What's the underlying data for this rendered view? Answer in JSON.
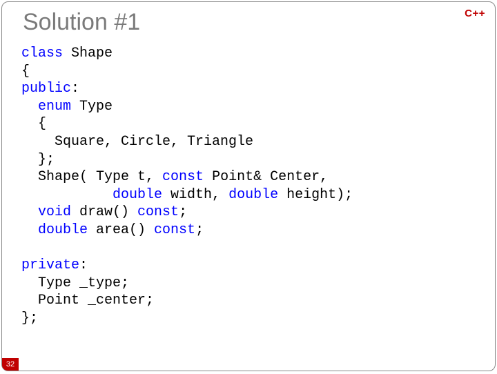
{
  "badge": "C++",
  "title": "Solution #1",
  "page_number": "32",
  "code": {
    "l1_a": "class",
    "l1_b": " Shape",
    "l2": "{",
    "l3_a": "public",
    "l3_b": ":",
    "l4_a": "  ",
    "l4_b": "enum",
    "l4_c": " Type",
    "l5": "  {",
    "l6": "    Square, Circle, Triangle",
    "l7": "  };",
    "l8_a": "  Shape( Type t, ",
    "l8_b": "const",
    "l8_c": " Point& Center,",
    "l9_a": "           ",
    "l9_b": "double",
    "l9_c": " width, ",
    "l9_d": "double",
    "l9_e": " height);",
    "l10_a": "  ",
    "l10_b": "void",
    "l10_c": " draw() ",
    "l10_d": "const",
    "l10_e": ";",
    "l11_a": "  ",
    "l11_b": "double",
    "l11_c": " area() ",
    "l11_d": "const",
    "l11_e": ";",
    "l12": "",
    "l13_a": "private",
    "l13_b": ":",
    "l14": "  Type _type;",
    "l15": "  Point _center;",
    "l16": "};"
  }
}
